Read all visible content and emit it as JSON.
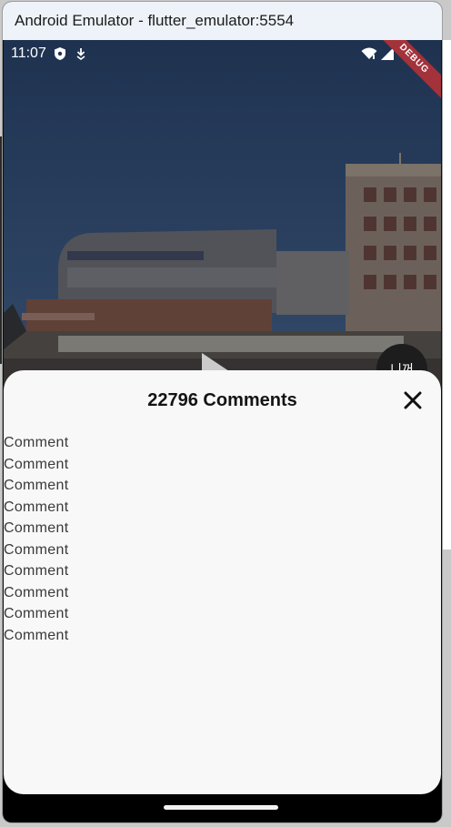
{
  "window": {
    "title": "Android Emulator - flutter_emulator:5554"
  },
  "status_bar": {
    "time": "11:07",
    "left_icons": [
      "shield-icon",
      "download-icon"
    ],
    "right_icons": [
      "wifi-icon",
      "signal-icon"
    ]
  },
  "debug_banner": "DEBUG",
  "video": {
    "avatar_label": "니꺼"
  },
  "comments_sheet": {
    "title": "22796 Comments",
    "close_icon": "close-icon",
    "items": [
      "Comment",
      "Comment",
      "Comment",
      "Comment",
      "Comment",
      "Comment",
      "Comment",
      "Comment",
      "Comment",
      "Comment"
    ]
  },
  "colors": {
    "title_bar": "#eef3f9",
    "debug_banner": "#a4323a",
    "sheet_background": "#f8f8f8",
    "comment_text": "#3a3a3a"
  }
}
